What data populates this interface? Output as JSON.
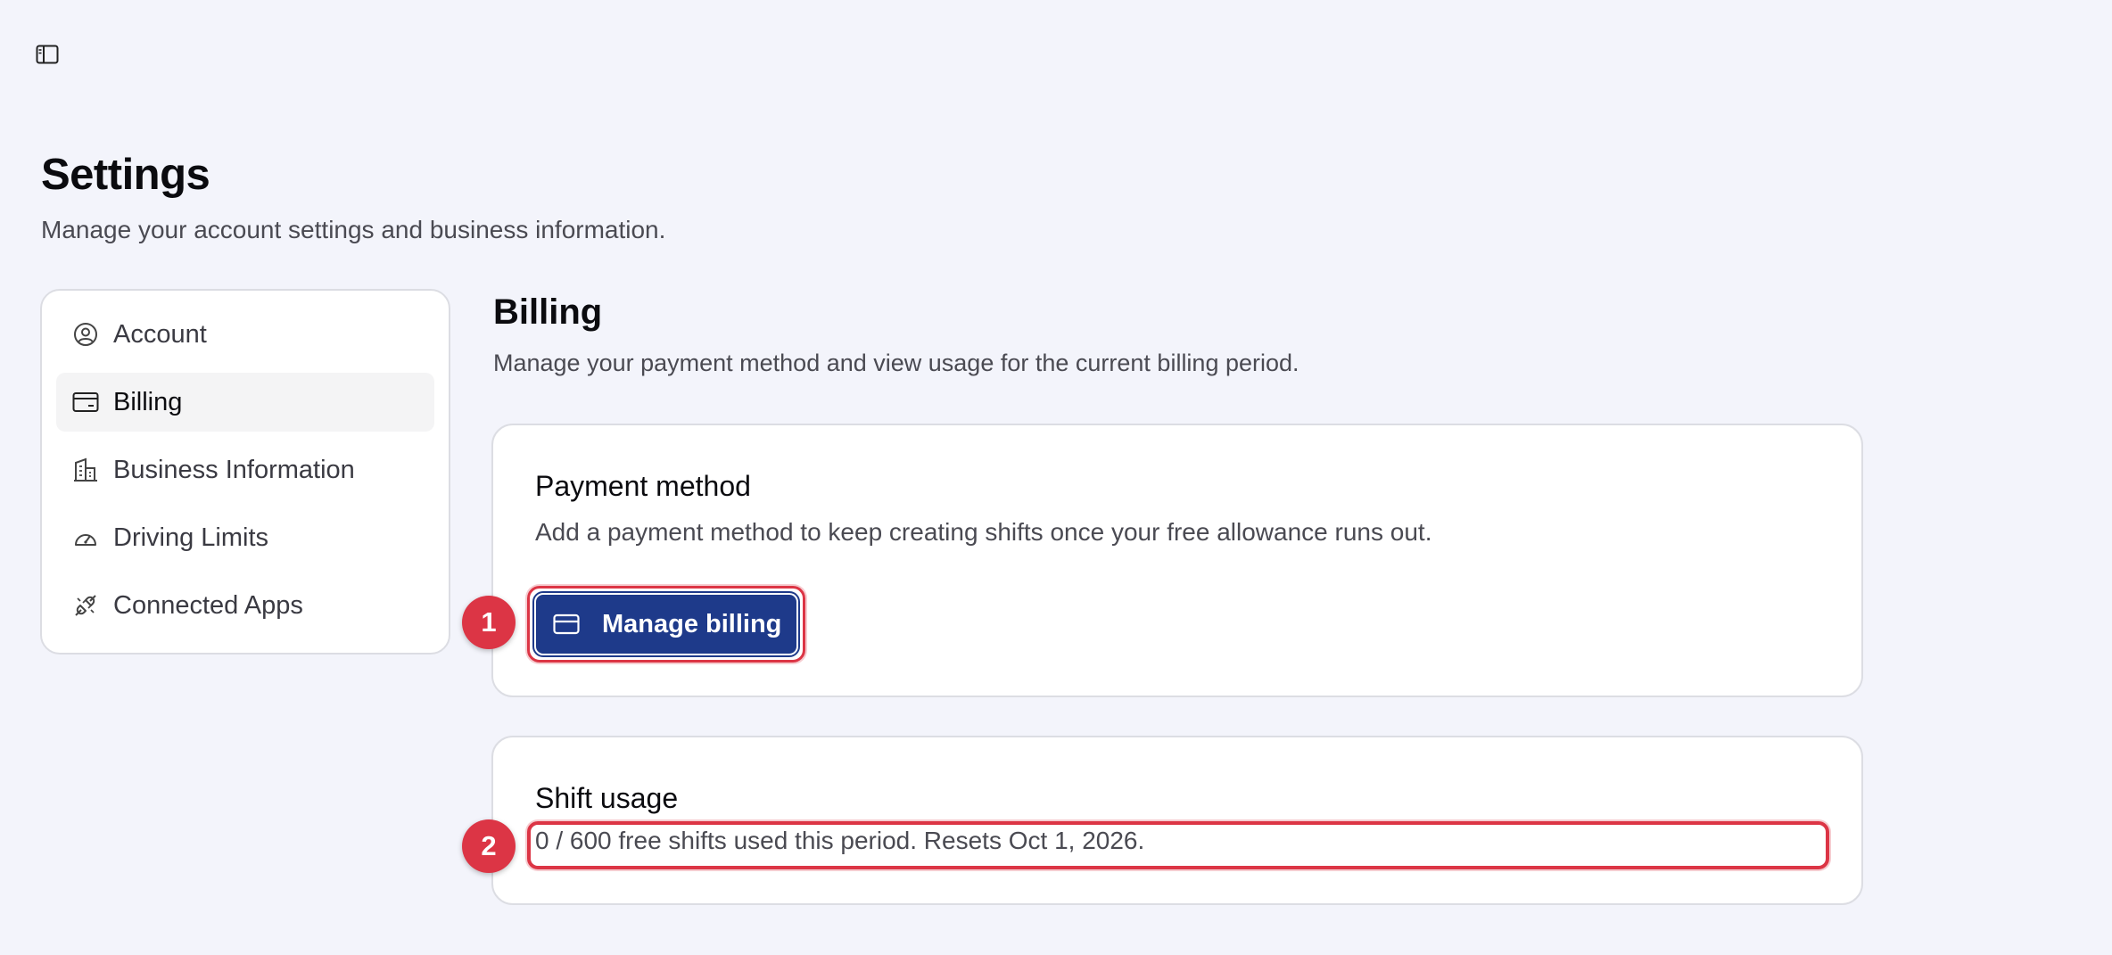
{
  "header": {
    "sidebar_toggle_icon": "sidebar-panel-icon",
    "title": "Settings",
    "subtitle": "Manage your account settings and business information."
  },
  "nav": {
    "items": [
      {
        "label": "Account",
        "icon": "user-circle-icon",
        "active": false
      },
      {
        "label": "Billing",
        "icon": "credit-card-icon",
        "active": true
      },
      {
        "label": "Business Information",
        "icon": "building-icon",
        "active": false
      },
      {
        "label": "Driving Limits",
        "icon": "gauge-icon",
        "active": false
      },
      {
        "label": "Connected Apps",
        "icon": "plug-icon",
        "active": false
      }
    ]
  },
  "billing": {
    "title": "Billing",
    "subtitle": "Manage your payment method and view usage for the current billing period.",
    "payment": {
      "title": "Payment method",
      "description": "Add a payment method to keep creating shifts once your free allowance runs out.",
      "button_label": "Manage billing",
      "button_icon": "credit-card-icon"
    },
    "usage": {
      "title": "Shift usage",
      "text": "0 / 600 free shifts used this period. Resets Oct 1, 2026."
    }
  },
  "annotations": {
    "marker_1": "1",
    "marker_2": "2"
  },
  "colors": {
    "background": "#f3f4fb",
    "primary_button": "#1e3a8a",
    "annotation_red": "#dc3545"
  }
}
